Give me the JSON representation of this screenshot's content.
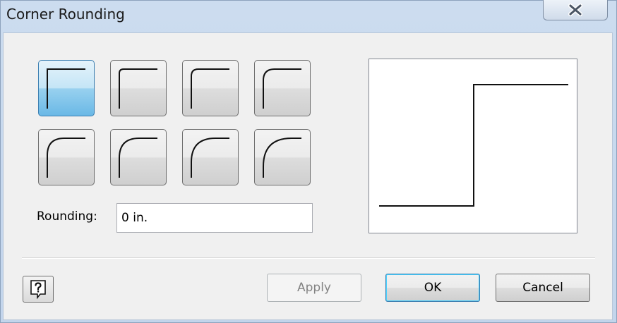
{
  "window": {
    "title": "Corner Rounding",
    "close_icon": "close-icon"
  },
  "styles": {
    "tiles": [
      {
        "name": "corner-style-square",
        "selected": true
      },
      {
        "name": "corner-style-1",
        "selected": false
      },
      {
        "name": "corner-style-2",
        "selected": false
      },
      {
        "name": "corner-style-3",
        "selected": false
      },
      {
        "name": "corner-style-4",
        "selected": false
      },
      {
        "name": "corner-style-5",
        "selected": false
      },
      {
        "name": "corner-style-6",
        "selected": false
      },
      {
        "name": "corner-style-7",
        "selected": false
      }
    ]
  },
  "rounding": {
    "label": "Rounding:",
    "value": "0 in."
  },
  "buttons": {
    "help_icon": "help-icon",
    "apply": "Apply",
    "ok": "OK",
    "cancel": "Cancel"
  }
}
